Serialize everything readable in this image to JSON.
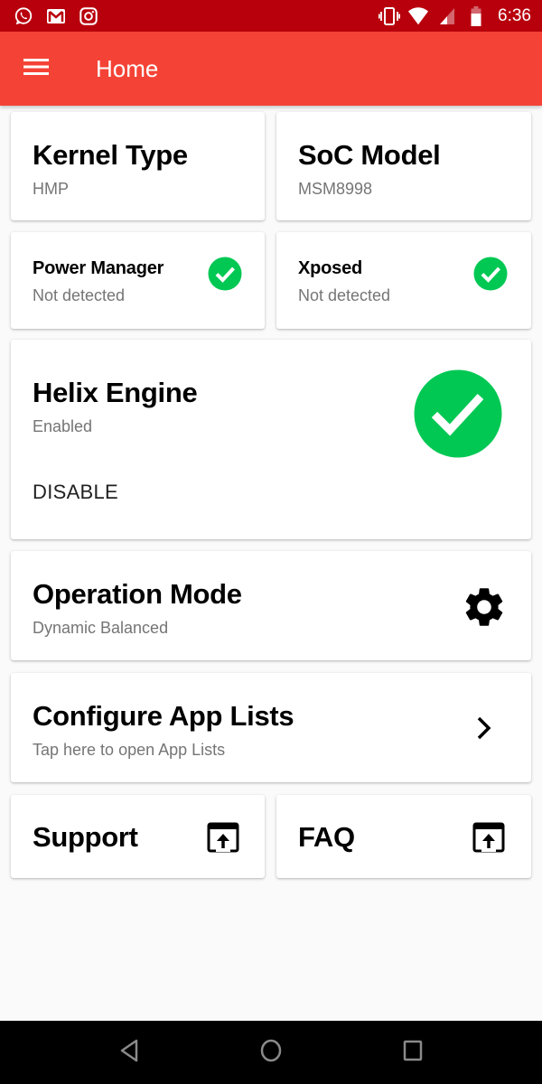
{
  "status_bar": {
    "notification_icons": [
      "whatsapp-icon",
      "gmail-icon",
      "instagram-icon"
    ],
    "system_icons": [
      "vibrate-icon",
      "wifi-icon",
      "signal-icon",
      "battery-icon"
    ],
    "time": "6:36"
  },
  "app_bar": {
    "title": "Home",
    "menu_icon": "hamburger-menu-icon"
  },
  "cards": {
    "kernel_type": {
      "title": "Kernel Type",
      "value": "HMP"
    },
    "soc_model": {
      "title": "SoC Model",
      "value": "MSM8998"
    },
    "power_manager": {
      "title": "Power Manager",
      "value": "Not detected",
      "icon": "check-circle-icon"
    },
    "xposed": {
      "title": "Xposed",
      "value": "Not detected",
      "icon": "check-circle-icon"
    },
    "helix_engine": {
      "title": "Helix Engine",
      "status": "Enabled",
      "action_label": "DISABLE",
      "icon": "check-circle-icon"
    },
    "operation_mode": {
      "title": "Operation Mode",
      "value": "Dynamic Balanced",
      "icon": "gear-icon"
    },
    "app_lists": {
      "title": "Configure App Lists",
      "subtitle": "Tap here to open App Lists",
      "icon": "chevron-right-icon"
    },
    "support": {
      "title": "Support",
      "icon": "open-in-browser-icon"
    },
    "faq": {
      "title": "FAQ",
      "icon": "open-in-browser-icon"
    }
  },
  "nav_bar": {
    "back": "back-icon",
    "home": "home-icon",
    "recents": "recents-icon"
  },
  "colors": {
    "status_bar": "#b8000d",
    "primary": "#f44336",
    "success": "#00c853",
    "background": "#fafafa"
  }
}
